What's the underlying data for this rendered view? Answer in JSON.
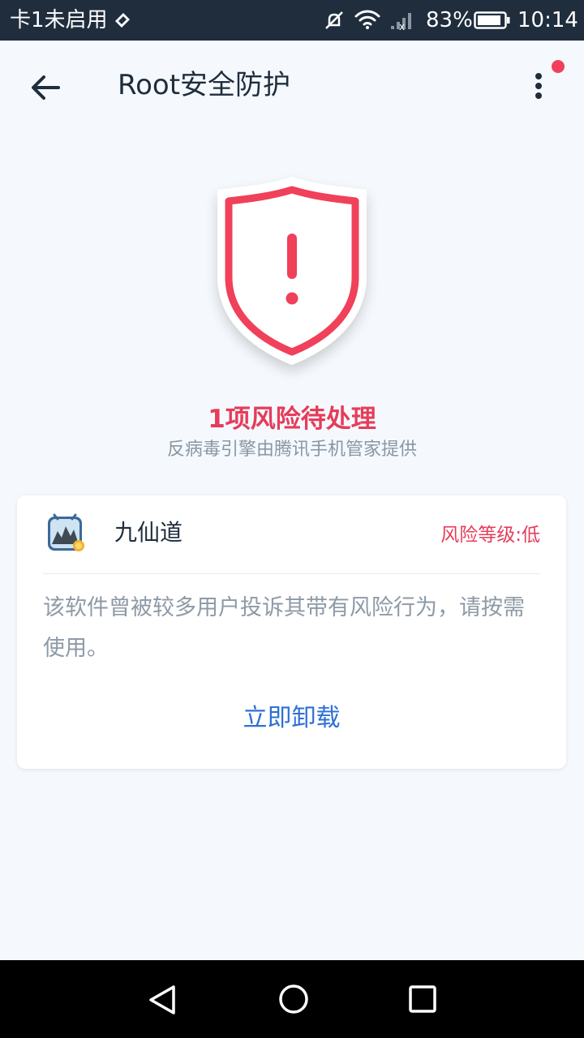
{
  "status_bar": {
    "carrier": "卡1未启用",
    "battery_percent": "83%",
    "time": "10:14",
    "icons": [
      "sim-icon",
      "mute-icon",
      "wifi-icon",
      "signal-icon",
      "battery-icon"
    ]
  },
  "header": {
    "title": "Root安全防护",
    "back_icon": "arrow-left-icon",
    "more_icon": "more-vert-icon",
    "has_notification_dot": true
  },
  "summary": {
    "risk_title": "1项风险待处理",
    "engine_note": "反病毒引擎由腾讯手机管家提供",
    "shield_icon": "shield-alert-icon"
  },
  "risk_item": {
    "app_name": "九仙道",
    "risk_level": "风险等级:低",
    "description": "该软件曾被较多用户投诉其带有风险行为，请按需使用。",
    "action_label": "立即卸载"
  },
  "colors": {
    "accent_red": "#e63c5a",
    "action_blue": "#2f6fd6",
    "background": "#f5f9fd",
    "status_bar": "#1f2d3d"
  }
}
